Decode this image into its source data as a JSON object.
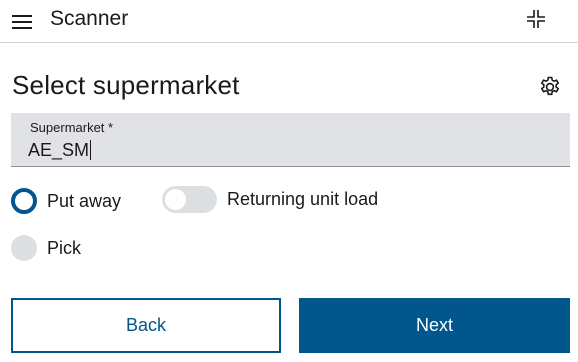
{
  "appbar": {
    "title": "Scanner",
    "menu_icon": "hamburger-menu-icon",
    "scan_icon": "scan-crosshair-icon"
  },
  "page": {
    "title": "Select supermarket",
    "settings_icon": "gear-icon"
  },
  "supermarket_field": {
    "label": "Supermarket *",
    "value": "AE_SM"
  },
  "mode": {
    "options": [
      {
        "label": "Put away",
        "selected": true
      },
      {
        "label": "Pick",
        "selected": false
      }
    ]
  },
  "returning_toggle": {
    "label": "Returning unit load",
    "on": false
  },
  "buttons": {
    "back_label": "Back",
    "next_label": "Next"
  },
  "colors": {
    "primary": "#00568d",
    "field_background": "#e0e2e5",
    "inactive_control": "#dcdfe2"
  }
}
